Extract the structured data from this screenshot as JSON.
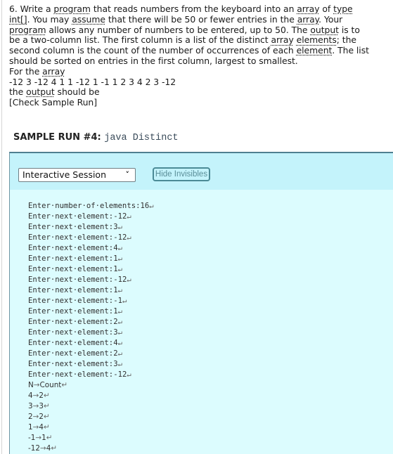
{
  "question": {
    "lines": [
      [
        {
          "t": "6. Write a "
        },
        {
          "u": "program"
        },
        {
          "t": " that reads numbers from the keyboard into an "
        },
        {
          "u": "array"
        },
        {
          "t": " of "
        },
        {
          "u": "type"
        }
      ],
      [
        {
          "u": "int[]"
        },
        {
          "t": ". You may "
        },
        {
          "u": "assume"
        },
        {
          "t": " that there will be 50 or fewer entries in the "
        },
        {
          "u": "array"
        },
        {
          "t": ". Your"
        }
      ],
      [
        {
          "u": "program"
        },
        {
          "t": " allows any number of numbers to be entered, up to 50. The "
        },
        {
          "u": "output"
        },
        {
          "t": " is to"
        }
      ],
      [
        {
          "t": "be a two-column list. The first column is a list of the distinct "
        },
        {
          "u": "array"
        },
        {
          "t": " "
        },
        {
          "u": "elements"
        },
        {
          "t": "; the"
        }
      ],
      [
        {
          "t": "second column is the count of the number of occurrences of each "
        },
        {
          "u": "element"
        },
        {
          "t": ". The list"
        }
      ],
      [
        {
          "t": "should be sorted on entries in the first column, largest to smallest."
        }
      ],
      [
        {
          "t": "For the "
        },
        {
          "u": "array"
        }
      ],
      [
        {
          "t": "-12 3 -12 4 1 1 -12 1 -1 1 2 3 4 2 3 -12"
        }
      ],
      [
        {
          "t": "the "
        },
        {
          "u": "output"
        },
        {
          "t": " should be"
        }
      ],
      [
        {
          "t": "[Check Sample Run]"
        }
      ]
    ]
  },
  "sample_run": {
    "label": "SAMPLE RUN #4:",
    "command": "java Distinct"
  },
  "panel": {
    "session_select_value": "Interactive Session",
    "hide_invisibles_label": "Hide Invisibles"
  },
  "console": {
    "prompt_lines": [
      {
        "prompt": "Enter·number·of·elements:",
        "value": "16"
      },
      {
        "prompt": "Enter·next·element:",
        "value": "-12"
      },
      {
        "prompt": "Enter·next·element:",
        "value": "3"
      },
      {
        "prompt": "Enter·next·element:",
        "value": "-12"
      },
      {
        "prompt": "Enter·next·element:",
        "value": "4"
      },
      {
        "prompt": "Enter·next·element:",
        "value": "1"
      },
      {
        "prompt": "Enter·next·element:",
        "value": "1"
      },
      {
        "prompt": "Enter·next·element:",
        "value": "-12"
      },
      {
        "prompt": "Enter·next·element:",
        "value": "1"
      },
      {
        "prompt": "Enter·next·element:",
        "value": "-1"
      },
      {
        "prompt": "Enter·next·element:",
        "value": "1"
      },
      {
        "prompt": "Enter·next·element:",
        "value": "2"
      },
      {
        "prompt": "Enter·next·element:",
        "value": "3"
      },
      {
        "prompt": "Enter·next·element:",
        "value": "4"
      },
      {
        "prompt": "Enter·next·element:",
        "value": "2"
      },
      {
        "prompt": "Enter·next·element:",
        "value": "3"
      },
      {
        "prompt": "Enter·next·element:",
        "value": "-12"
      }
    ],
    "table_header": [
      "N",
      "Count"
    ],
    "table_rows": [
      [
        "4",
        "2"
      ],
      [
        "3",
        "3"
      ],
      [
        "2",
        "2"
      ],
      [
        "1",
        "4"
      ],
      [
        "-1",
        "1"
      ],
      [
        "-12",
        "4"
      ]
    ],
    "newline_glyph": "↵",
    "tab_glyph": "→"
  }
}
